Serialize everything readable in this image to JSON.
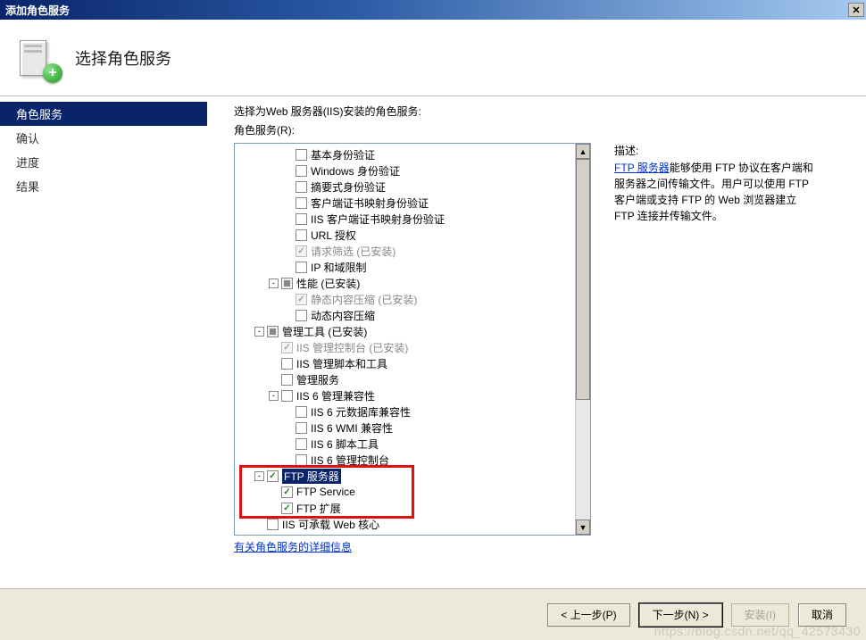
{
  "window": {
    "title": "添加角色服务"
  },
  "header": {
    "title": "选择角色服务"
  },
  "sidebar": {
    "items": [
      {
        "label": "角色服务",
        "active": true
      },
      {
        "label": "确认",
        "active": false
      },
      {
        "label": "进度",
        "active": false
      },
      {
        "label": "结果",
        "active": false
      }
    ]
  },
  "main": {
    "instruction": "选择为Web 服务器(IIS)安装的角色服务:",
    "list_label": "角色服务(R):",
    "info_link": "有关角色服务的详细信息"
  },
  "tree": [
    {
      "indent": 3,
      "cb": "none",
      "label": "基本身份验证"
    },
    {
      "indent": 3,
      "cb": "none",
      "label": "Windows 身份验证"
    },
    {
      "indent": 3,
      "cb": "none",
      "label": "摘要式身份验证"
    },
    {
      "indent": 3,
      "cb": "none",
      "label": "客户端证书映射身份验证"
    },
    {
      "indent": 3,
      "cb": "none",
      "label": "IIS 客户端证书映射身份验证"
    },
    {
      "indent": 3,
      "cb": "none",
      "label": "URL 授权"
    },
    {
      "indent": 3,
      "cb": "chkdis",
      "label": "请求筛选  (已安装)",
      "disabled": true
    },
    {
      "indent": 3,
      "cb": "none",
      "label": "IP 和域限制"
    },
    {
      "indent": 2,
      "exp": "-",
      "cb": "tri",
      "label": "性能  (已安装)"
    },
    {
      "indent": 3,
      "cb": "chkdis",
      "label": "静态内容压缩  (已安装)",
      "disabled": true
    },
    {
      "indent": 3,
      "cb": "none",
      "label": "动态内容压缩"
    },
    {
      "indent": 1,
      "exp": "-",
      "cb": "tri",
      "label": "管理工具  (已安装)"
    },
    {
      "indent": 2,
      "cb": "chkdis",
      "label": "IIS 管理控制台  (已安装)",
      "disabled": true
    },
    {
      "indent": 2,
      "cb": "none",
      "label": "IIS 管理脚本和工具"
    },
    {
      "indent": 2,
      "cb": "none",
      "label": "管理服务"
    },
    {
      "indent": 2,
      "exp": "-",
      "cb": "none",
      "label": "IIS 6 管理兼容性"
    },
    {
      "indent": 3,
      "cb": "none",
      "label": "IIS 6 元数据库兼容性"
    },
    {
      "indent": 3,
      "cb": "none",
      "label": "IIS 6 WMI 兼容性"
    },
    {
      "indent": 3,
      "cb": "none",
      "label": "IIS 6 脚本工具"
    },
    {
      "indent": 3,
      "cb": "none",
      "label": "IIS 6 管理控制台"
    },
    {
      "indent": 1,
      "exp": "-",
      "cb": "chk",
      "label": "FTP 服务器",
      "selected": true
    },
    {
      "indent": 2,
      "cb": "chk",
      "label": "FTP Service"
    },
    {
      "indent": 2,
      "cb": "chk",
      "label": "FTP 扩展"
    },
    {
      "indent": 1,
      "cb": "none",
      "label": "IIS 可承载 Web 核心"
    }
  ],
  "description": {
    "title": "描述:",
    "link_text": "FTP 服务器",
    "body": "能够使用 FTP 协议在客户端和服务器之间传输文件。用户可以使用 FTP 客户端或支持 FTP 的 Web 浏览器建立 FTP 连接并传输文件。"
  },
  "buttons": {
    "prev": "< 上一步(P)",
    "next": "下一步(N) >",
    "install": "安装(I)",
    "cancel": "取消"
  },
  "watermark": "https://blog.csdn.net/qq_42573430"
}
